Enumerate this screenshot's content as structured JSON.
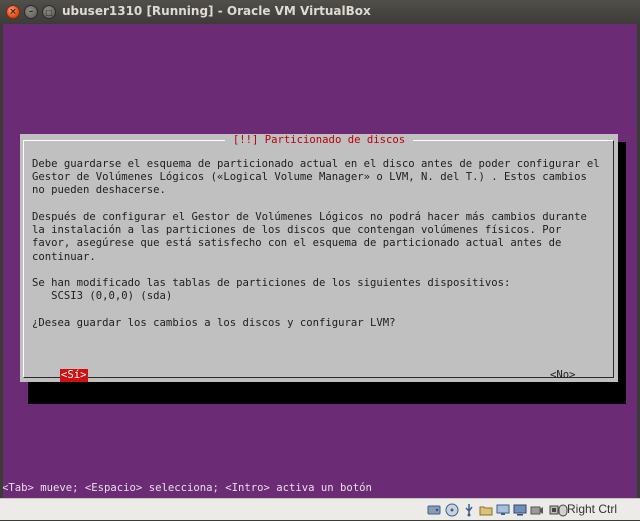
{
  "window": {
    "title": "ubuser1310 [Running] - Oracle VM VirtualBox",
    "close_glyph": "×",
    "minimize_glyph": "–",
    "maximize_glyph": "□"
  },
  "installer": {
    "dialog_title": "[!!] Particionado de discos",
    "paragraph1": "Debe guardarse el esquema de particionado actual en el disco antes de poder configurar el\nGestor de Volúmenes Lógicos («Logical Volume Manager» o LVM, N. del T.) . Estos cambios\nno pueden deshacerse.",
    "paragraph2": "Después de configurar el Gestor de Volúmenes Lógicos no podrá hacer más cambios durante\nla instalación a las particiones de los discos que contengan volúmenes físicos. Por\nfavor, asegúrese que está satisfecho con el esquema de particionado actual antes de\ncontinuar.",
    "paragraph3": "Se han modificado las tablas de particiones de los siguientes dispositivos:\n   SCSI3 (0,0,0) (sda)",
    "question": "¿Desea guardar los cambios a los discos y configurar LVM?",
    "yes_button": "<Sí>",
    "no_button": "<No>",
    "key_hint": "<Tab> mueve; <Espacio> selecciona; <Intro> activa un botón"
  },
  "statusbar": {
    "icons": [
      "hard-disk-icon",
      "optical-drive-icon",
      "usb-icon",
      "shared-folders-icon",
      "network-icon",
      "display-icon",
      "video-capture-icon",
      "cpu-icon",
      "mouse-integration-icon"
    ],
    "host_key": "Right Ctrl"
  },
  "colors": {
    "screen_bg": "#6c2b75",
    "dialog_bg": "#c0c0c0",
    "title_red": "#b7000b",
    "selected_button": "#d01010"
  }
}
